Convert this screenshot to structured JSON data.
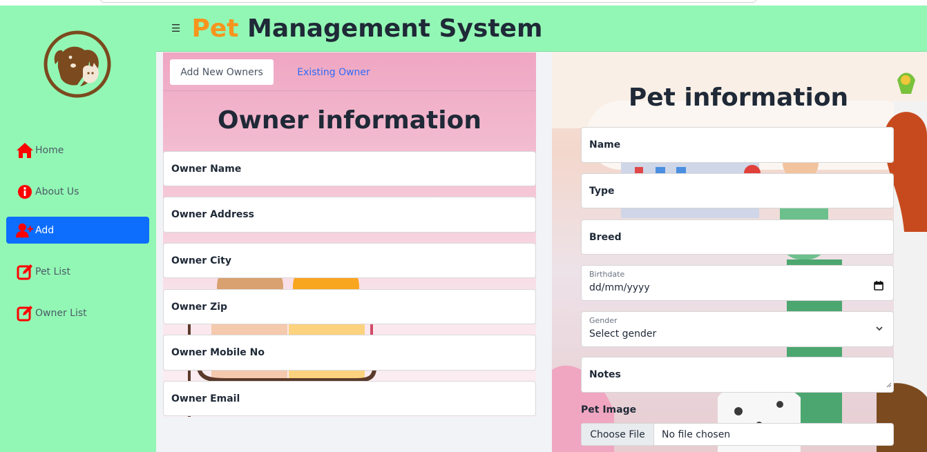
{
  "app": {
    "title_accent": "Pet",
    "title_rest": " Management System",
    "menu_icon": "hamburger-icon"
  },
  "sidebar": {
    "logo_icon": "pet-logo-icon",
    "items": [
      {
        "label": "Home",
        "icon": "home-icon",
        "active": false
      },
      {
        "label": "About Us",
        "icon": "info-icon",
        "active": false
      },
      {
        "label": "Add",
        "icon": "add-user-icon",
        "active": true
      },
      {
        "label": "Pet List",
        "icon": "edit-icon",
        "active": false
      },
      {
        "label": "Owner List",
        "icon": "edit-icon",
        "active": false
      }
    ]
  },
  "owner_form": {
    "tabs": [
      {
        "label": "Add New Owners",
        "active": true
      },
      {
        "label": "Existing Owner",
        "active": false
      }
    ],
    "heading": "Owner information",
    "fields": [
      "Owner Name",
      "Owner Address",
      "Owner City",
      "Owner Zip",
      "Owner Mobile No",
      "Owner Email"
    ]
  },
  "pet_form": {
    "heading": "Pet information",
    "name_label": "Name",
    "type_label": "Type",
    "breed_label": "Breed",
    "birthdate_label": "Birthdate",
    "birthdate_value": "dd/mm/yyyy",
    "gender_label": "Gender",
    "gender_value": "Select gender",
    "notes_label": "Notes",
    "image_label": "Pet Image",
    "choose_file": "Choose File",
    "no_file": "No file chosen"
  },
  "colors": {
    "accent": "#f7941d",
    "sidebar_bg": "#92f7b4",
    "active_nav": "#0d6efd",
    "icon_red": "#ff0000",
    "link_blue": "#2f6bf5"
  }
}
